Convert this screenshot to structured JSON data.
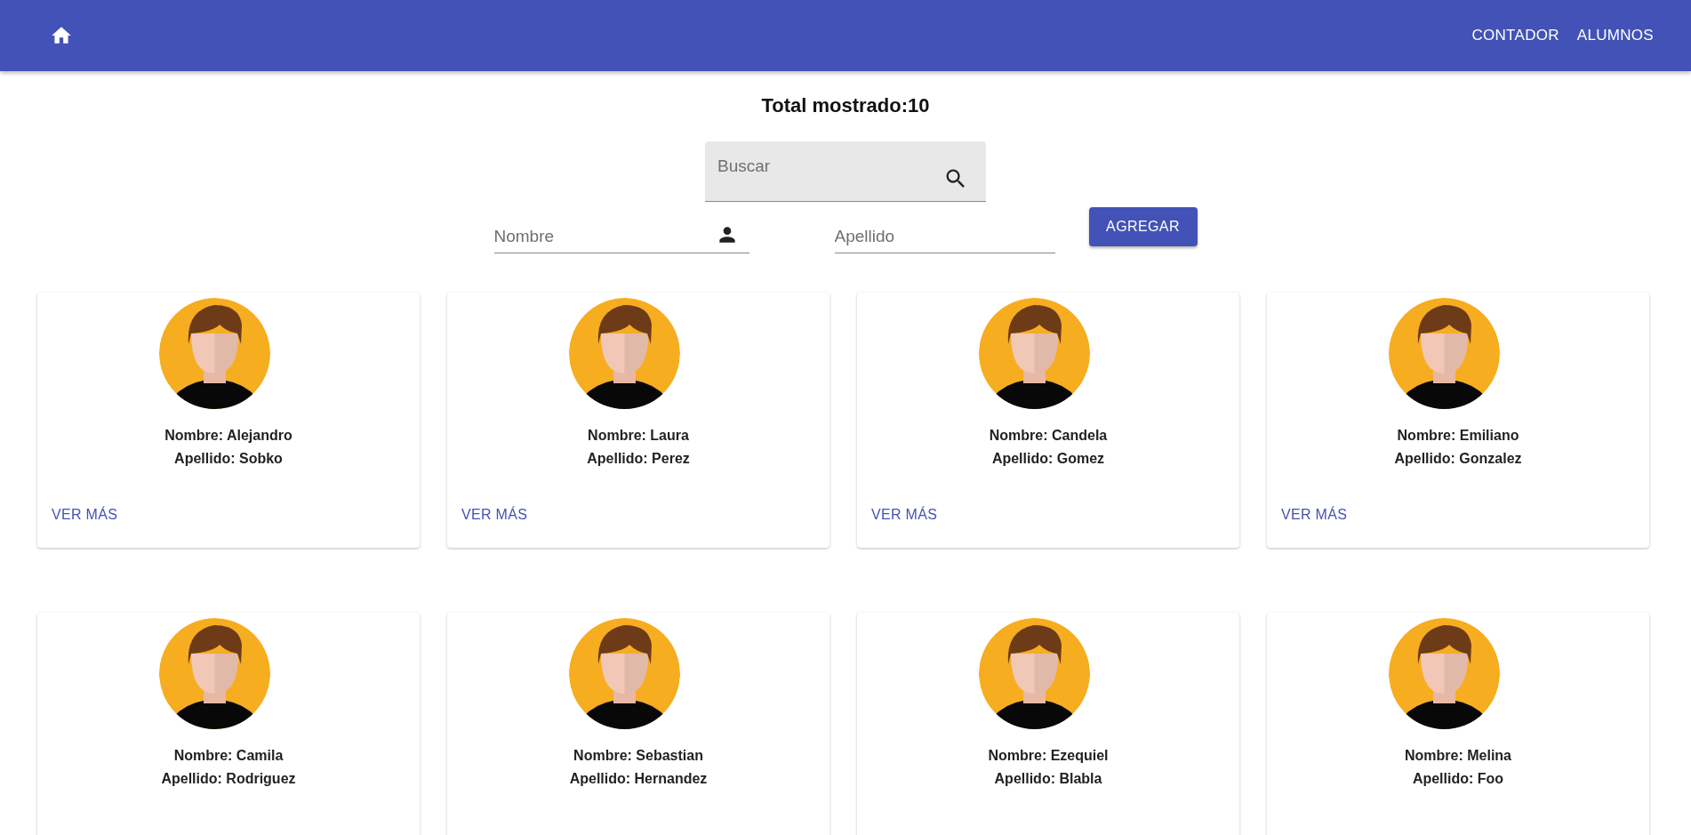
{
  "nav": {
    "links": [
      "CONTADOR",
      "ALUMNOS"
    ]
  },
  "total": "Total mostrado:10",
  "search": {
    "placeholder": "Buscar"
  },
  "form": {
    "nombre_placeholder": "Nombre",
    "apellido_placeholder": "Apellido",
    "button": "AGREGAR"
  },
  "cards": [
    {
      "nombre": "Nombre: Alejandro",
      "apellido": "Apellido: Sobko",
      "action": "VER MÁS"
    },
    {
      "nombre": "Nombre: Laura",
      "apellido": "Apellido: Perez",
      "action": "VER MÁS"
    },
    {
      "nombre": "Nombre: Candela",
      "apellido": "Apellido: Gomez",
      "action": "VER MÁS"
    },
    {
      "nombre": "Nombre: Emiliano",
      "apellido": "Apellido: Gonzalez",
      "action": "VER MÁS"
    },
    {
      "nombre": "Nombre: Camila",
      "apellido": "Apellido: Rodriguez"
    },
    {
      "nombre": "Nombre: Sebastian",
      "apellido": "Apellido: Hernandez"
    },
    {
      "nombre": "Nombre: Ezequiel",
      "apellido": "Apellido: Blabla"
    },
    {
      "nombre": "Nombre: Melina",
      "apellido": "Apellido: Foo"
    }
  ]
}
